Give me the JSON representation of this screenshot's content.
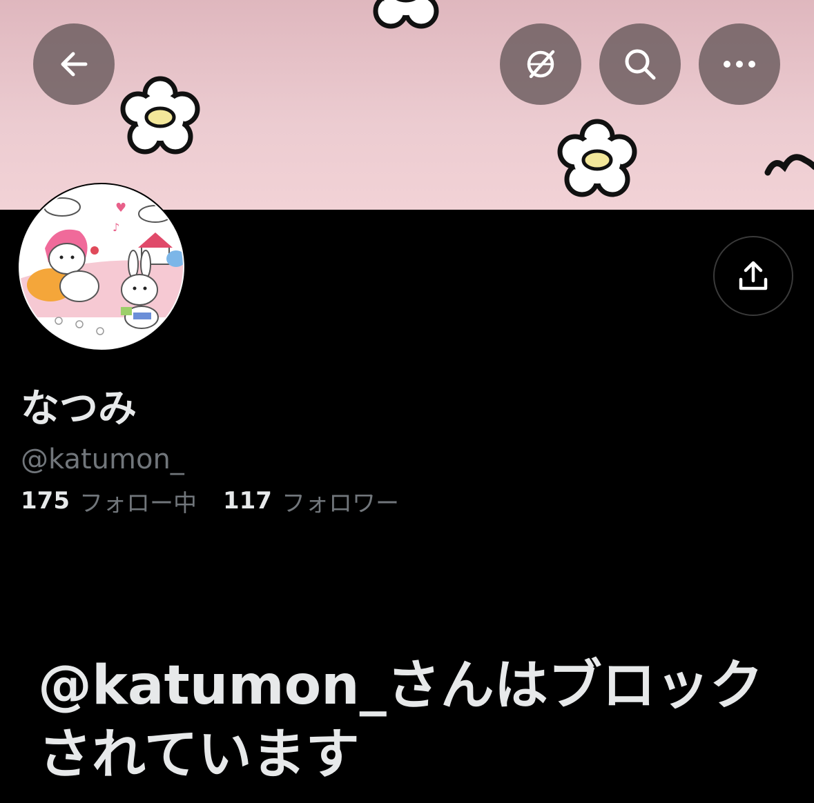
{
  "header": {
    "back_icon": "arrow-left-icon",
    "translate_icon": "no-translate-icon",
    "search_icon": "search-icon",
    "more_icon": "more-horizontal-icon"
  },
  "profile": {
    "display_name": "なつみ",
    "handle": "@katumon_",
    "following_count": "175",
    "following_label": "フォロー中",
    "followers_count": "117",
    "followers_label": "フォロワー",
    "share_icon": "share-icon"
  },
  "blocked_message": "@katumon_さんはブロックされています",
  "colors": {
    "background": "#000000",
    "text_primary": "#e7e9ea",
    "text_secondary": "#71767b",
    "banner_pink": "#ecccd1"
  }
}
